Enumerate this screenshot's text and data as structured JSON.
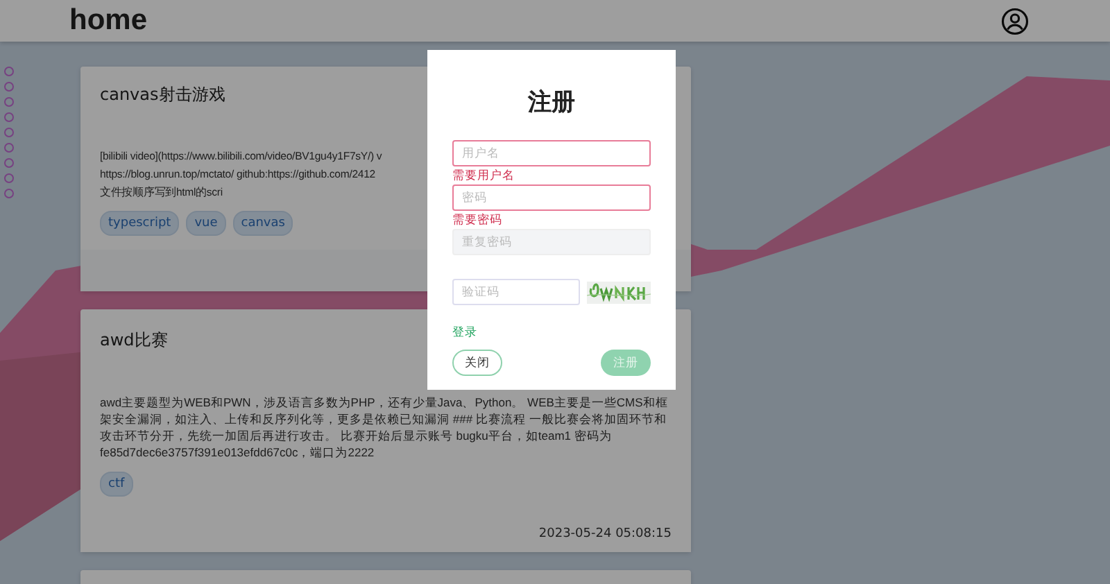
{
  "header": {
    "title": "home"
  },
  "page_dots": [
    {
      "selected": false
    },
    {
      "selected": false
    },
    {
      "selected": false
    },
    {
      "selected": false
    },
    {
      "selected": false
    },
    {
      "selected": false
    },
    {
      "selected": false
    },
    {
      "selected": false
    },
    {
      "selected": false
    }
  ],
  "posts": [
    {
      "title": "canvas射击游戏",
      "lines": [
        "[bilibili video](https://www.bilibili.com/video/BV1gu4y1F7sY/) v",
        "https://blog.unrun.top/mctato/ github:https://github.com/2412",
        "文件按顺序写到html的scri"
      ],
      "tags": [
        "typescript",
        "vue",
        "canvas"
      ]
    },
    {
      "title": "awd比赛",
      "text": "awd主要题型为WEB和PWN，涉及语言多数为PHP，还有少量Java、Python。 WEB主要是一些CMS和框架安全漏洞，如注入、上传和反序列化等，更多是依赖已知漏洞 ### 比赛流程 一般比赛会将加固环节和攻击环节分开，先统一加固后再进行攻击。 比赛开始后显示账号 bugku平台，如team1 密码为fe85d7dec6e3757f391e013efdd67c0c，端口为2222",
      "tags": [
        "ctf"
      ],
      "date": "2023-05-24 05:08:15"
    }
  ],
  "dialog": {
    "title": "注册",
    "fields": [
      {
        "placeholder": "用户名",
        "error": "需要用户名",
        "disabled": false
      },
      {
        "placeholder": "密码",
        "error": "需要密码",
        "disabled": false
      },
      {
        "placeholder": "重复密码",
        "disabled": true
      }
    ],
    "captcha": {
      "placeholder": "验证码"
    },
    "login_link": "登录",
    "close_button": "关闭",
    "submit_button": {
      "label": "注册",
      "disabled": true
    }
  }
}
